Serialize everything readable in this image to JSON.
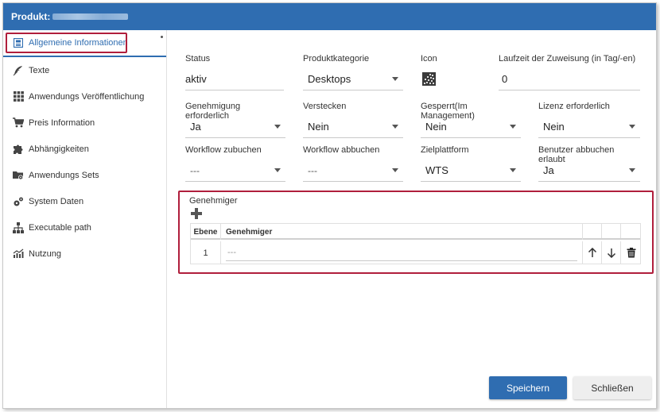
{
  "window": {
    "title": "Produkt:"
  },
  "sidebar": {
    "items": [
      {
        "label": "Allgemeine Informationen",
        "icon": "info-box-icon",
        "active": true
      },
      {
        "label": "Texte",
        "icon": "feather-icon"
      },
      {
        "label": "Anwendungs Veröffentlichung",
        "icon": "grid-icon"
      },
      {
        "label": "Preis Information",
        "icon": "cart-icon"
      },
      {
        "label": "Abhängigkeiten",
        "icon": "puzzle-icon"
      },
      {
        "label": "Anwendungs Sets",
        "icon": "folder-gear-icon"
      },
      {
        "label": "System Daten",
        "icon": "gears-icon"
      },
      {
        "label": "Executable path",
        "icon": "sitemap-icon"
      },
      {
        "label": "Nutzung",
        "icon": "chart-icon"
      }
    ]
  },
  "form": {
    "status": {
      "label": "Status",
      "value": "aktiv"
    },
    "produktkategorie": {
      "label": "Produktkategorie",
      "value": "Desktops"
    },
    "icon": {
      "label": "Icon"
    },
    "laufzeit": {
      "label": "Laufzeit der Zuweisung (in Tag/-en)",
      "value": "0"
    },
    "genehmigung": {
      "label": "Genehmigung erforderlich",
      "value": "Ja"
    },
    "verstecken": {
      "label": "Verstecken",
      "value": "Nein"
    },
    "gesperrt": {
      "label": "Gesperrt(Im Management)",
      "value": "Nein"
    },
    "lizenz": {
      "label": "Lizenz erforderlich",
      "value": "Nein"
    },
    "workflow_zu": {
      "label": "Workflow zubuchen",
      "value": "---"
    },
    "workflow_ab": {
      "label": "Workflow abbuchen",
      "value": "---"
    },
    "zielplattform": {
      "label": "Zielplattform",
      "value": "WTS"
    },
    "benutzer_abbuchen": {
      "label": "Benutzer abbuchen erlaubt",
      "value": "Ja"
    }
  },
  "approvers": {
    "label": "Genehmiger",
    "columns": [
      "Ebene",
      "Genehmiger"
    ],
    "rows": [
      {
        "ebene": "1",
        "genehmiger": "---"
      }
    ]
  },
  "buttons": {
    "save": "Speichern",
    "close": "Schließen"
  },
  "colors": {
    "accent": "#2f6db1",
    "highlight": "#b01e3c"
  }
}
